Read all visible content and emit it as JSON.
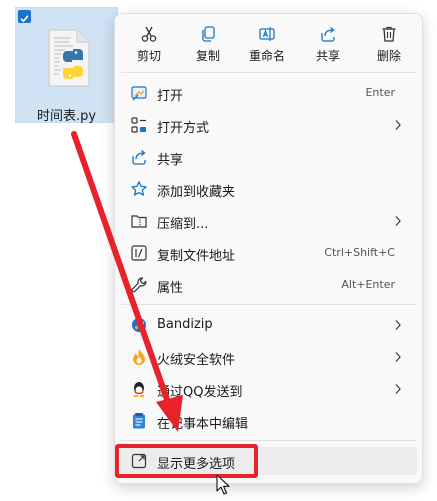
{
  "file": {
    "name": "时间表.py",
    "icon": "python-file-icon",
    "selected": true
  },
  "toolbar": {
    "cut_label": "剪切",
    "copy_label": "复制",
    "rename_label": "重命名",
    "share_label": "共享",
    "delete_label": "删除"
  },
  "menu": {
    "items": [
      {
        "label": "打开",
        "shortcut": "Enter",
        "icon": "open-icon"
      },
      {
        "label": "打开方式",
        "submenu": true,
        "icon": "open-with-icon"
      },
      {
        "label": "共享",
        "icon": "share-icon"
      },
      {
        "label": "添加到收藏夹",
        "icon": "star-icon"
      },
      {
        "label": "压缩到...",
        "submenu": true,
        "icon": "zip-folder-icon"
      },
      {
        "label": "复制文件地址",
        "shortcut": "Ctrl+Shift+C",
        "icon": "copy-path-icon"
      },
      {
        "label": "属性",
        "shortcut": "Alt+Enter",
        "icon": "wrench-icon"
      },
      {
        "label": "Bandizip",
        "submenu": true,
        "icon": "bandizip-icon"
      },
      {
        "label": "火绒安全软件",
        "submenu": true,
        "icon": "huorong-icon"
      },
      {
        "label": "通过QQ发送到",
        "submenu": true,
        "icon": "qq-icon"
      },
      {
        "label": "在记事本中编辑",
        "icon": "notepad-icon"
      },
      {
        "label": "显示更多选项",
        "icon": "more-options-icon",
        "highlighted": true
      }
    ]
  },
  "colors": {
    "annotation": "#e8222a",
    "selection": "#cfe3f4",
    "accent": "#1a73c9"
  }
}
